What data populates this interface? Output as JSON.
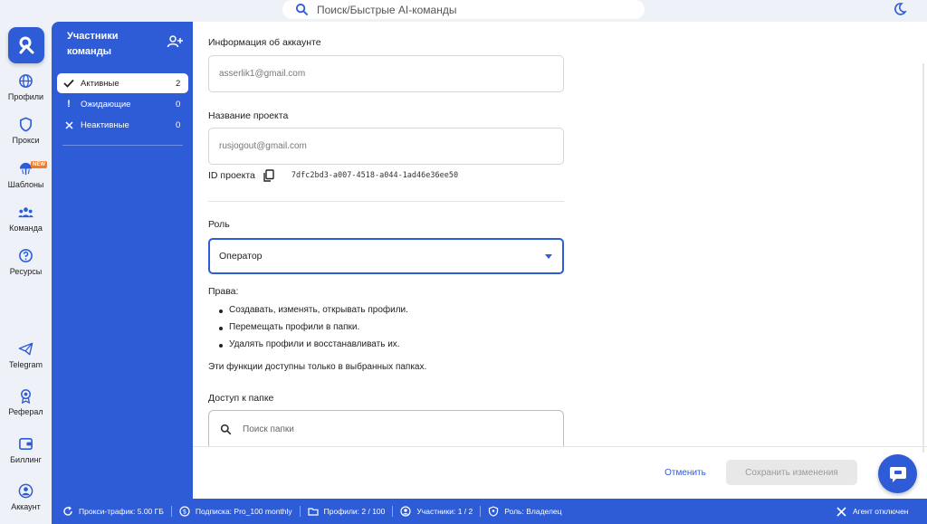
{
  "search": {
    "placeholder": "Поиск/Быстрые AI-команды"
  },
  "rail": {
    "items": [
      {
        "label": "Профили",
        "icon": "globe-icon"
      },
      {
        "label": "Прокси",
        "icon": "shield-icon"
      },
      {
        "label": "Шаблоны",
        "icon": "template-icon",
        "badge": "NEW"
      },
      {
        "label": "Команда",
        "icon": "team-icon"
      },
      {
        "label": "Ресурсы",
        "icon": "help-icon"
      },
      {
        "label": "Telegram",
        "icon": "telegram-icon"
      },
      {
        "label": "Реферал",
        "icon": "referral-icon"
      },
      {
        "label": "Биллинг",
        "icon": "wallet-icon"
      },
      {
        "label": "Аккаунт",
        "icon": "account-icon"
      }
    ]
  },
  "team": {
    "title": "Участники команды",
    "filters": [
      {
        "label": "Активные",
        "count": "2",
        "icon": "check-icon"
      },
      {
        "label": "Ожидающие",
        "count": "0",
        "icon": "exclamation-icon"
      },
      {
        "label": "Неактивные",
        "count": "0",
        "icon": "cross-icon"
      }
    ]
  },
  "main": {
    "account_info_label": "Информация об аккаунте",
    "account_email": "asserlik1@gmail.com",
    "project_name_label": "Название проекта",
    "project_name": "rusjogout@gmail.com",
    "project_id_label": "ID проекта",
    "project_id": "7dfc2bd3-a007-4518-a044-1ad46e36ee50",
    "role_label": "Роль",
    "role_value": "Оператор",
    "rights_label": "Права:",
    "rights": [
      "Создавать, изменять, открывать профили.",
      "Перемещать профили в папки.",
      "Удалять профили и восстанавливать их."
    ],
    "rights_note": "Эти функции доступны только в выбранных папках.",
    "folder_access_label": "Доступ к папке",
    "folder_search_placeholder": "Поиск папки",
    "cancel_label": "Отменить",
    "save_label": "Сохранить изменения"
  },
  "status_bar": {
    "proxy_traffic": "Прокси-трафик: 5.00 ГБ",
    "subscription": "Подписка: Pro_100 monthly",
    "profiles": "Профили: 2 / 100",
    "members": "Участники: 1 / 2",
    "role": "Роль: Владелец",
    "agent": "Агент отключен"
  },
  "colors": {
    "brand": "#2e5bd6",
    "badge": "#f47b20"
  }
}
